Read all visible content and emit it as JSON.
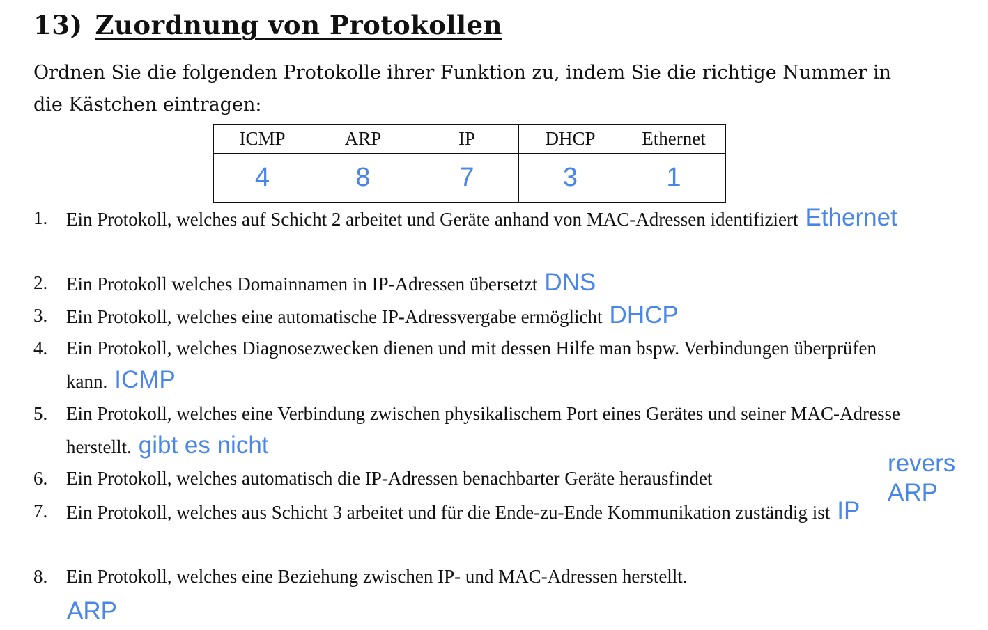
{
  "title": {
    "number": "13)",
    "text": "Zuordnung von Protokollen"
  },
  "intro": "Ordnen Sie die folgenden Protokolle ihrer Funktion zu, indem Sie die richtige Nummer in die Kästchen eintragen:",
  "table": {
    "headers": [
      "ICMP",
      "ARP",
      "IP",
      "DHCP",
      "Ethernet"
    ],
    "answers": [
      "4",
      "8",
      "7",
      "3",
      "1"
    ]
  },
  "items": [
    {
      "num": "1.",
      "text": "Ein Protokoll, welches auf Schicht 2 arbeitet und Geräte anhand von MAC-Adressen identifiziert",
      "answer": "Ethernet"
    },
    {
      "num": "2.",
      "text": "Ein Protokoll welches Domainnamen in IP-Adressen übersetzt",
      "answer": "DNS"
    },
    {
      "num": "3.",
      "text": "Ein Protokoll, welches eine automatische IP-Adressvergabe ermöglicht",
      "answer": "DHCP"
    },
    {
      "num": "4.",
      "text": "Ein Protokoll, welches Diagnosezwecken dienen und mit dessen Hilfe man bspw. Verbindungen überprüfen kann.",
      "answer": "ICMP"
    },
    {
      "num": "5.",
      "text": "Ein Protokoll, welches eine Verbindung zwischen physikalischem Port eines Gerätes und seiner MAC-Adresse herstellt.",
      "answer": "gibt es nicht"
    },
    {
      "num": "6.",
      "text": "Ein Protokoll, welches automatisch die IP-Adressen benachbarter Geräte herausfindet",
      "answer_line1": "revers",
      "answer_line2": "ARP"
    },
    {
      "num": "7.",
      "text": "Ein Protokoll, welches aus Schicht 3 arbeitet und für die Ende-zu-Ende Kommunikation zuständig ist",
      "answer": "IP"
    },
    {
      "num": "8.",
      "text": "Ein Protokoll, welches eine Beziehung zwischen IP- und MAC-Adressen herstellt.",
      "answer": "ARP"
    }
  ],
  "colors": {
    "handwriting": "#4a86e8",
    "text": "#111111"
  }
}
